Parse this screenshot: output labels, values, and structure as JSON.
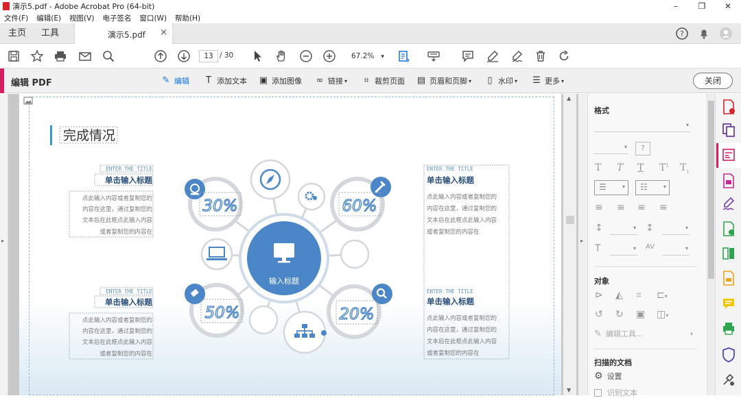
{
  "window": {
    "title": "演示5.pdf - Adobe Acrobat Pro (64-bit)"
  },
  "menu": [
    "文件(F)",
    "编辑(E)",
    "视图(V)",
    "电子签名",
    "窗口(W)",
    "帮助(H)"
  ],
  "tabs": {
    "home": "主页",
    "tools": "工具",
    "doc": "演示5.pdf",
    "doc_close": "×"
  },
  "toolbar": {
    "page_current": "13",
    "page_total": "/ 30",
    "zoom": "67.2%"
  },
  "editbar": {
    "title": "编辑 PDF",
    "items": [
      "编辑",
      "添加文本",
      "添加图像",
      "链接",
      "裁剪页面",
      "页眉和页脚",
      "水印",
      "更多"
    ],
    "close": "关闭"
  },
  "slide": {
    "heading": "完成情况",
    "center_label": "输入标题",
    "percents": [
      "30%",
      "60%",
      "50%",
      "20%"
    ],
    "blocks": [
      {
        "eng": "ENTER THE TITLE",
        "title": "单击输入标题",
        "lines": [
          "点此输入内容或者复制您的",
          "内容在这里，通过复制您的",
          "文本后在此框点此输入内容",
          "或者复制您的内容在"
        ]
      },
      {
        "eng": "ENTER THE TITLE",
        "title": "单击输入标题",
        "lines": [
          "点此输入内容或者复制您的",
          "内容在这里，通过复制您的",
          "文本后在此框点此输入内容",
          "或者复制您的内容在"
        ]
      },
      {
        "eng": "ENTER THE TITLE",
        "title": "单击输入标题",
        "lines": [
          "点此输入内容或者复制您的",
          "内容在这里，通过复制您的",
          "文本后在此框点此输入内容",
          "或者复制您的内容在"
        ]
      },
      {
        "eng": "ENTER THE TITLE",
        "title": "单击输入标题",
        "lines": [
          "点此输入内容或者复制您的",
          "内容在这里，通过复制您的",
          "文本后在此框点此输入内容",
          "或者复制您的内容在"
        ]
      }
    ]
  },
  "panel": {
    "format": "格式",
    "object": "对象",
    "edit_image": "编辑工具...",
    "scanned": "扫描的文档",
    "settings": "设置",
    "recognize": "识别文本"
  },
  "colors": {
    "accent": "#d81e63",
    "slide_blue": "#4a86c8",
    "ring_gray": "#d4d8dc"
  }
}
